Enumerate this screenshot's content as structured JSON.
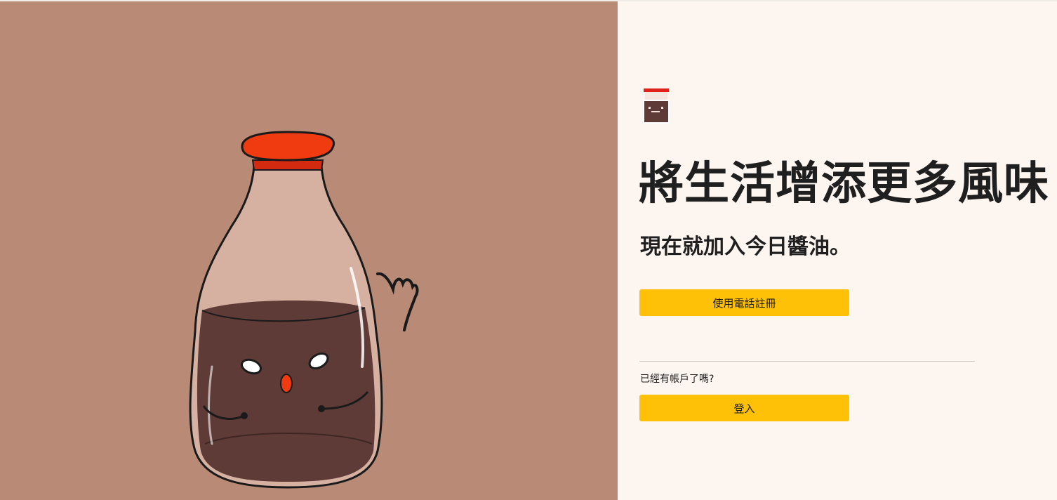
{
  "hero": {
    "illustration": "soy-sauce-bottle-character",
    "background_color": "#b98a76",
    "cap_color": "#f03a10",
    "sauce_color": "#5e3b36"
  },
  "panel": {
    "logo_icon": "soy-sauce-bottle-icon",
    "headline": "將生活增添更多風味",
    "subheadline": "現在就加入今日醬油。",
    "signup_phone_label": "使用電話註冊",
    "existing_account_text": "已經有帳戶了嗎?",
    "login_label": "登入",
    "accent_color": "#ffc107"
  }
}
